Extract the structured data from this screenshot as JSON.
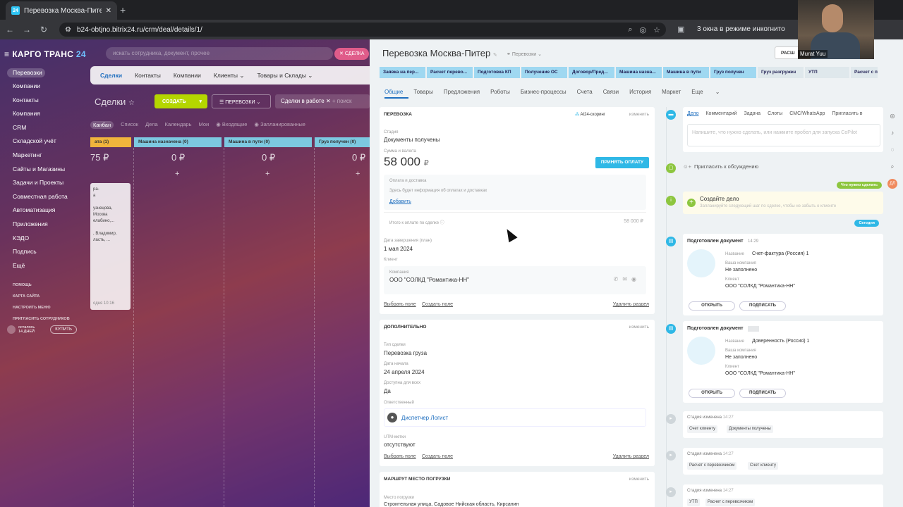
{
  "browser": {
    "tab_title": "Перевозка Москва-Питер",
    "favicon_text": "24",
    "url": "b24-obtjno.bitrix24.ru/crm/deal/details/1/",
    "incognito_label": "3 окна в режиме инкогнито",
    "new_tab": "+",
    "close_tab": "✕"
  },
  "crm": {
    "brand": "КАРГО ТРАНС",
    "brand_num": "24",
    "search_placeholder": "искать сотрудника, документ, прочее",
    "deal_button": "СДЕЛКА",
    "nav": [
      "Перевозки",
      "Компании",
      "Контакты",
      "Компания",
      "CRM",
      "Складской учёт",
      "Маркетинг",
      "Сайты и Магазины",
      "Задачи и Проекты",
      "Совместная работа",
      "Автоматизация",
      "Приложения",
      "КЭДО",
      "Подпись",
      "Ещё"
    ],
    "nav_small": [
      "ПОМОЩЬ",
      "КАРТА САЙТА",
      "НАСТРОИТЬ МЕНЮ",
      "ПРИГЛАСИТЬ СОТРУДНИКОВ"
    ],
    "trial": {
      "line1": "осталось",
      "line2": "14 ДНЕЙ",
      "buy": "КУПИТЬ"
    },
    "tabs": [
      "Сделки",
      "Контакты",
      "Компании",
      "Клиенты",
      "Товары и Склады"
    ],
    "page_title": "Сделки",
    "create_btn": "СОЗДАТЬ",
    "funnel": "ПЕРЕВОЗКИ",
    "filter": "Сделки в работе",
    "filter_hint": "+ поиск",
    "views": [
      "Канбан",
      "Список",
      "Дела",
      "Календарь",
      "Мои",
      "Входящие",
      "Запланированные"
    ],
    "columns": [
      {
        "name": "ата (1)",
        "sum": "75 ₽"
      },
      {
        "name": "Машина назначена (0)",
        "sum": "0 ₽"
      },
      {
        "name": "Машина в пути (0)",
        "sum": "0 ₽"
      },
      {
        "name": "Груз получен (0)",
        "sum": "0 ₽"
      }
    ],
    "card": {
      "line1": "ра-",
      "line2": "а",
      "line3": "узнецова,",
      "line4": "Москва",
      "line5": "елабино,...",
      "line6": ", Владимир,",
      "line7": "ласть, ...",
      "footer": "одня 10:16"
    }
  },
  "deal": {
    "title": "Перевозка Москва-Питер",
    "category": "Перевозки",
    "expand_btn": "РАСШ",
    "stages": [
      "Заявка на пер...",
      "Расчет перево...",
      "Подготовка КП",
      "Получение ОС",
      "Договор/Пред...",
      "Машина назна...",
      "Машина в пути",
      "Груз получен",
      "Груз разгружен",
      "УТП",
      "Расчет с п"
    ],
    "tabs": [
      "Общие",
      "Товары",
      "Предложения",
      "Роботы",
      "Бизнес-процессы",
      "Счета",
      "Связи",
      "История",
      "Маркет",
      "Еще"
    ],
    "main": {
      "head": "ПЕРЕВОЗКА",
      "scoring": "AI24-скоринг",
      "change": "изменить",
      "stage_label": "Стадия",
      "stage_value": "Документы получены",
      "sum_label": "Сумма и валюта",
      "sum_value": "58 000",
      "currency": "₽",
      "accept_payment": "ПРИНЯТЬ ОПЛАТУ",
      "payment_label": "Оплата и доставка",
      "payment_hint": "Здесь будет информация об оплатах и доставках",
      "add_link": "Добавить",
      "total_label": "Итого к оплате по сделке",
      "total_value": "58 000 ₽",
      "close_date_label": "Дата завершения (план)",
      "close_date_value": "1 мая 2024",
      "client_label": "Клиент",
      "company_label": "Компания",
      "company_value": "ООО \"СОЛКД \"Романтика-НН\"",
      "choose_field": "Выбрать поле",
      "create_field": "Создать поле",
      "delete_section": "Удалить раздел"
    },
    "extra": {
      "head": "ДОПОЛНИТЕЛЬНО",
      "type_label": "Тип сделки",
      "type_value": "Перевозка груза",
      "start_label": "Дата начала",
      "start_value": "24 апреля 2024",
      "avail_label": "Доступна для всех",
      "avail_value": "Да",
      "resp_label": "Ответственный",
      "resp_value": "Диспетчер Логист",
      "utm_label": "UTM-метки",
      "utm_value": "отсутствуют"
    },
    "route": {
      "head": "МАРШРУТ МЕСТО ПОГРУЗКИ",
      "place_label": "Место погрузки",
      "place_value": "Строительная улица, Садовое Нийская область, Кирсанин"
    }
  },
  "timeline": {
    "tabs": [
      "Дело",
      "Комментарий",
      "Задача",
      "Слоты",
      "СМС/WhatsApp",
      "Пригласить в"
    ],
    "input_placeholder": "Напишите, что нужно сделать, или нажмите пробел для запуска CoPilot",
    "invite": "Пригласить к обсуждению",
    "todo_badge": "Что нужно сделать",
    "create_task": "Создайте дело",
    "create_task_hint": "Запланируйте следующий шаг по сделке, чтобы не забыть о клиенте",
    "today_badge": "Сегодня",
    "docs": [
      {
        "title": "Подготовлен документ",
        "time": "14:29",
        "name_label": "Название",
        "name": "Счет-фактура (Россия) 1",
        "company_label": "Ваша компания",
        "company": "Не заполнено",
        "client_label": "Клиент",
        "client": "ООО \"СОЛКД \"Романтика-НН\"",
        "open": "ОТКРЫТЬ",
        "sign": "ПОДПИСАТЬ"
      },
      {
        "title": "Подготовлен документ",
        "time": "",
        "name_label": "Название",
        "name": "Доверенность (Россия) 1",
        "company_label": "Ваша компания",
        "company": "Не заполнено",
        "client_label": "Клиент",
        "client": "ООО \"СОЛКД \"Романтика-НН\"",
        "open": "ОТКРЫТЬ",
        "sign": "ПОДПИСАТЬ"
      }
    ],
    "stage_changes": [
      {
        "title": "Стадия изменена",
        "time": "14:27",
        "from": "Счет клиенту",
        "to": "Документы получены"
      },
      {
        "title": "Стадия изменена",
        "time": "14:27",
        "from": "Расчет с перевозчиком",
        "to": "Счет клиенту"
      },
      {
        "title": "Стадия изменена",
        "time": "14:27",
        "from": "УТП",
        "to": "Расчет с перевозчиком"
      }
    ]
  },
  "webcam": {
    "name": "Murat Yuu"
  },
  "colors": {
    "accent": "#2fb8e6",
    "stage": "#9fd8f1",
    "create": "#b5d600",
    "link": "#1f6fbf"
  }
}
